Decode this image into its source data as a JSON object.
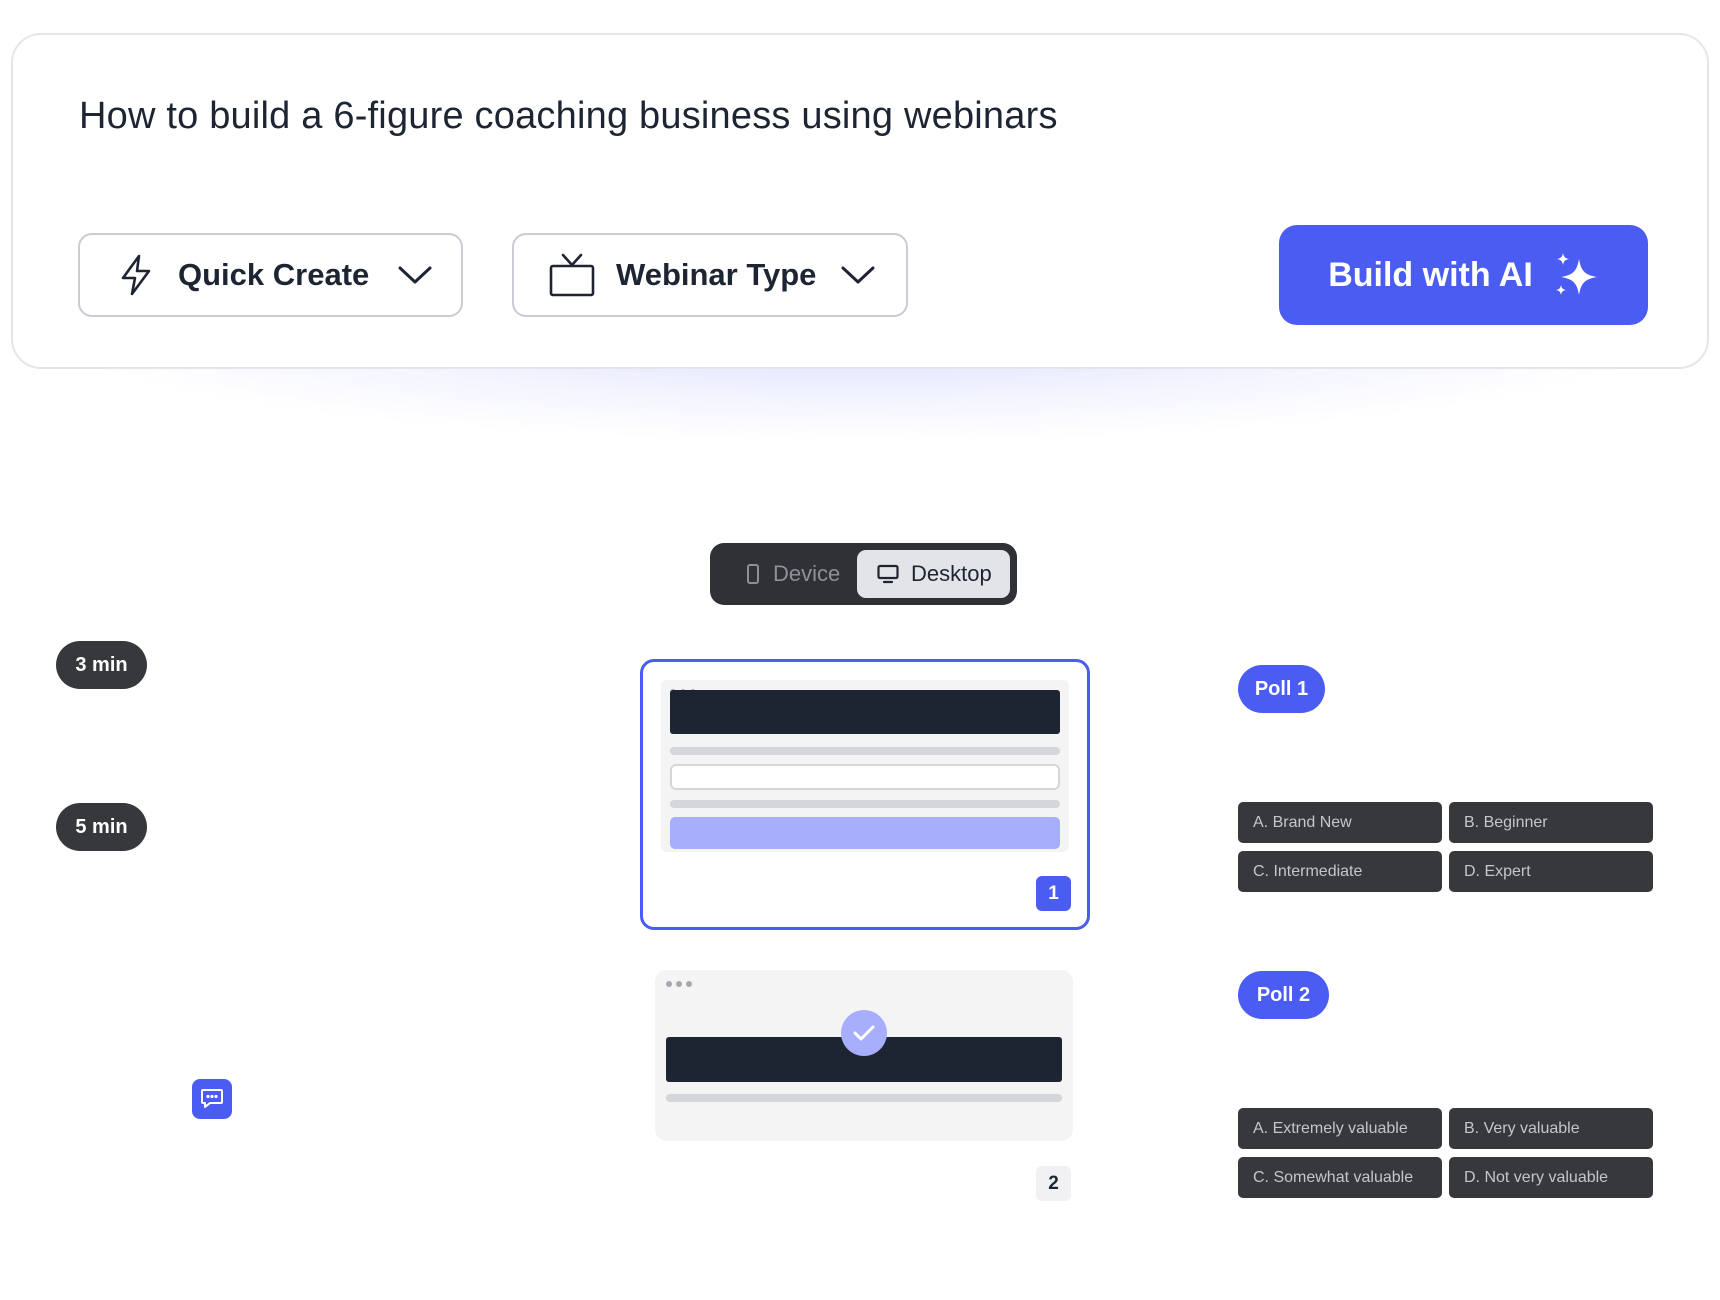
{
  "prompt": {
    "text": "How to build a 6-figure coaching business using webinars"
  },
  "controls": {
    "quick_create": {
      "label": "Quick Create",
      "icon": "lightning-icon"
    },
    "webinar_type": {
      "label": "Webinar Type",
      "icon": "tv-icon"
    },
    "build_button": {
      "label": "Build with AI",
      "icon": "sparkles-icon"
    }
  },
  "view_toggle": {
    "device_label": "Device",
    "desktop_label": "Desktop",
    "selected": "Desktop"
  },
  "timeline": {
    "times": [
      "3 min",
      "5 min"
    ]
  },
  "slides": [
    {
      "number": "1",
      "selected": true
    },
    {
      "number": "2",
      "selected": false
    }
  ],
  "polls": [
    {
      "label": "Poll 1",
      "options": [
        "A. Brand New",
        "B. Beginner",
        "C. Intermediate",
        "D. Expert"
      ]
    },
    {
      "label": "Poll 2",
      "options": [
        "A. Extremely valuable",
        "B. Very valuable",
        "C. Somewhat valuable",
        "D. Not very valuable"
      ]
    }
  ],
  "colors": {
    "accent": "#4b5cf2",
    "accent_light": "#a7aefc",
    "dark": "#37383c",
    "navy": "#1e2532"
  }
}
